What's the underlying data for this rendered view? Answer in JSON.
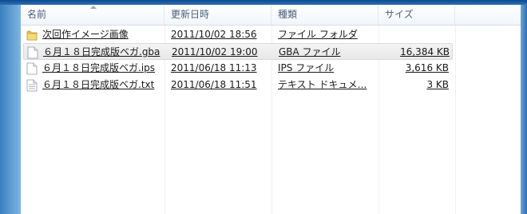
{
  "columns": {
    "name": "名前",
    "date": "更新日時",
    "type": "種類",
    "size": "サイズ"
  },
  "files": [
    {
      "name": "次回作イメージ画像",
      "date": "2011/10/02 18:56",
      "type": "ファイル フォルダ",
      "size": "",
      "icon": "folder-icon"
    },
    {
      "name": "６月１８日完成版ベガ.gba",
      "date": "2011/10/02 19:00",
      "type": "GBA ファイル",
      "size": "16,384 KB",
      "icon": "file-icon"
    },
    {
      "name": "６月１８日完成版ベガ.ips",
      "date": "2011/06/18 11:13",
      "type": "IPS ファイル",
      "size": "3,616 KB",
      "icon": "file-icon"
    },
    {
      "name": "６月１８日完成版ベガ.txt",
      "date": "2011/06/18 11:51",
      "type": "テキスト ドキュメ…",
      "size": "3 KB",
      "icon": "text-file-icon"
    }
  ],
  "selected_index": 1
}
